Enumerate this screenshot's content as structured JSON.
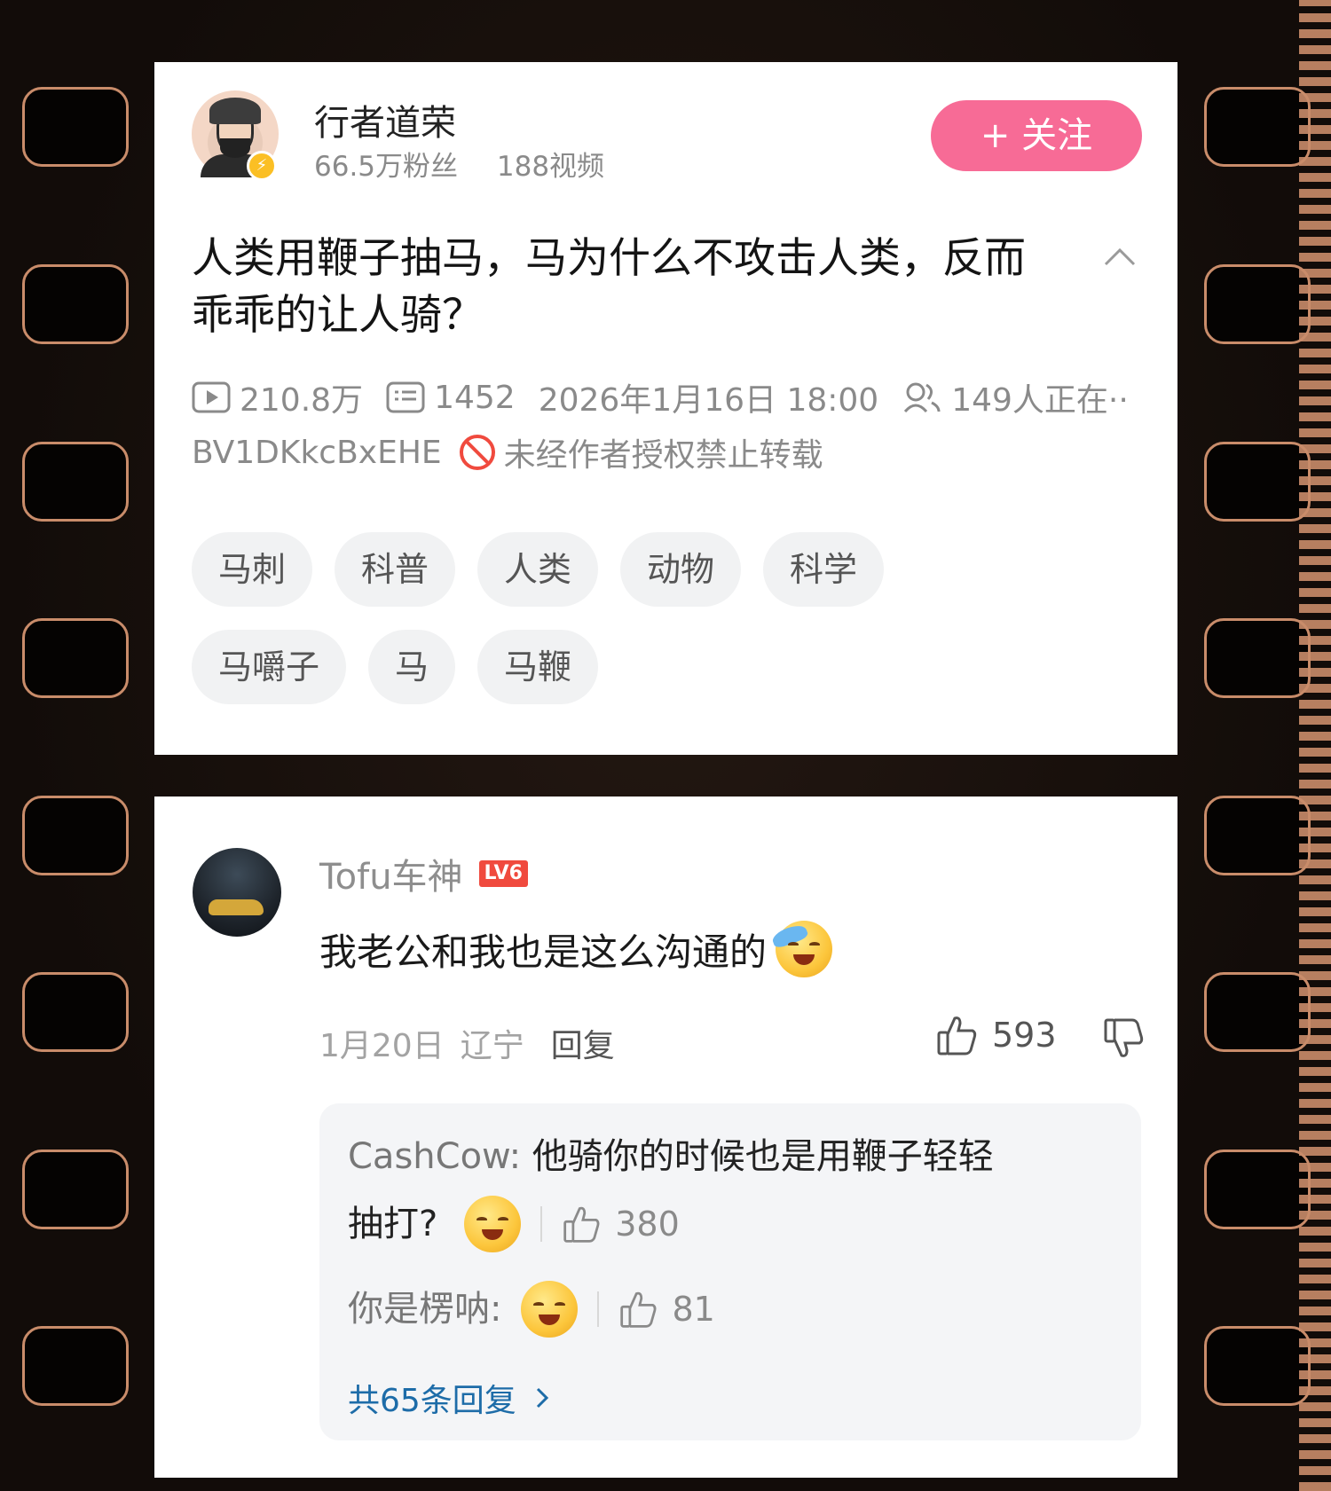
{
  "author": {
    "name": "行者道荣",
    "fans": "66.5万粉丝",
    "videos": "188视频",
    "follow_label": "+ 关注"
  },
  "video": {
    "title": "人类用鞭子抽马，马为什么不攻击人类，反而乖乖的让人骑？",
    "plays": "210.8万",
    "danmaku": "1452",
    "date": "2026年1月16日 18:00",
    "watching": "149人正在··",
    "bvid": "BV1DKkcBxEHE",
    "copyright": "未经作者授权禁止转载"
  },
  "tags": [
    "马刺",
    "科普",
    "人类",
    "动物",
    "科学",
    "马嚼子",
    "马",
    "马鞭"
  ],
  "comment": {
    "user": "Tofu车神",
    "level": "LV6",
    "text": "我老公和我也是这么沟通的",
    "date": "1月20日",
    "location": "辽宁",
    "reply_label": "回复",
    "likes": "593",
    "replies": [
      {
        "user": "CashCow:",
        "text": "他骑你的时候也是用鞭子轻轻",
        "text2": "抽打?",
        "likes": "380"
      },
      {
        "user": "你是楞呐:",
        "text": "",
        "likes": "81"
      }
    ],
    "more_label": "共65条回复"
  },
  "colors": {
    "follow_bg": "#f76b96",
    "link_blue": "#1d6ca8",
    "level_red": "#f04a3e",
    "film_orange": "#c98c6a"
  }
}
